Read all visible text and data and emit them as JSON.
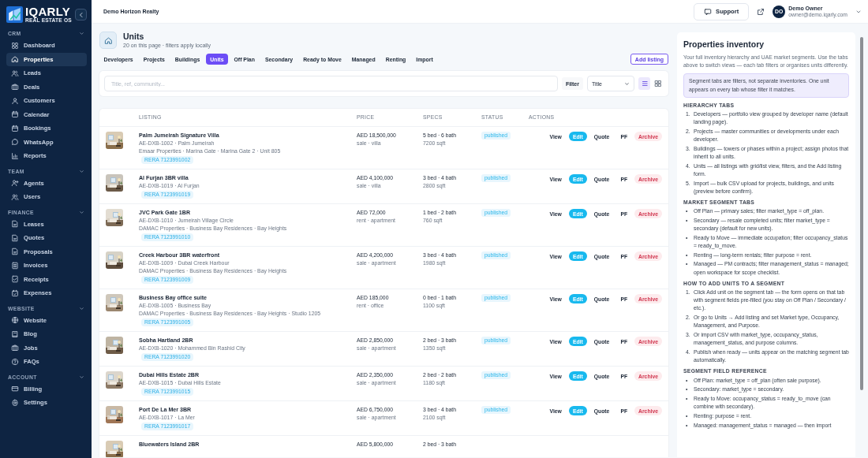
{
  "sidebar": {
    "logo": {
      "name": "IQARLY",
      "tagline": "REAL ESTATE OS"
    },
    "sections": [
      {
        "title": "CRM",
        "expanded": true,
        "items": [
          {
            "label": "Dashboard",
            "selected": false
          },
          {
            "label": "Properties",
            "selected": true
          },
          {
            "label": "Leads",
            "selected": false
          },
          {
            "label": "Deals",
            "selected": false
          },
          {
            "label": "Customers",
            "selected": false
          },
          {
            "label": "Calendar",
            "selected": false
          },
          {
            "label": "Bookings",
            "selected": false
          },
          {
            "label": "WhatsApp",
            "selected": false
          },
          {
            "label": "Reports",
            "selected": false
          }
        ]
      },
      {
        "title": "TEAM",
        "expanded": true,
        "items": [
          {
            "label": "Agents",
            "selected": false
          },
          {
            "label": "Users",
            "selected": false
          }
        ]
      },
      {
        "title": "FINANCE",
        "expanded": true,
        "items": [
          {
            "label": "Leases",
            "selected": false
          },
          {
            "label": "Quotes",
            "selected": false
          },
          {
            "label": "Proposals",
            "selected": false
          },
          {
            "label": "Invoices",
            "selected": false
          },
          {
            "label": "Receipts",
            "selected": false
          },
          {
            "label": "Expenses",
            "selected": false
          }
        ]
      },
      {
        "title": "WEBSITE",
        "expanded": true,
        "items": [
          {
            "label": "Website",
            "selected": false
          },
          {
            "label": "Blog",
            "selected": false
          },
          {
            "label": "Jobs",
            "selected": false
          },
          {
            "label": "FAQs",
            "selected": false
          }
        ]
      },
      {
        "title": "ACCOUNT",
        "expanded": true,
        "items": [
          {
            "label": "Billing",
            "selected": false
          },
          {
            "label": "Settings",
            "selected": false
          }
        ]
      }
    ]
  },
  "header": {
    "org": "Demo Horizon Realty",
    "support": "Support",
    "user": {
      "initials": "DO",
      "name": "Demo Owner",
      "email": "owner@demo.iqarly.com"
    }
  },
  "page": {
    "title": "Units",
    "subtitle": "20 on this page · filters apply locally",
    "tabs": [
      {
        "label": "Developers",
        "selected": false
      },
      {
        "label": "Projects",
        "selected": false
      },
      {
        "label": "Buildings",
        "selected": false
      },
      {
        "label": "Units",
        "selected": true
      },
      {
        "label": "Off Plan",
        "selected": false
      },
      {
        "label": "Secondary",
        "selected": false
      },
      {
        "label": "Ready to Move",
        "selected": false
      },
      {
        "label": "Managed",
        "selected": false
      },
      {
        "label": "Renting",
        "selected": false
      },
      {
        "label": "Import",
        "selected": false
      }
    ],
    "add_button": "Add listing",
    "search": {
      "placeholder": "Title, ref, community..."
    },
    "filter_button": "Filter",
    "sort": {
      "value": "Title"
    },
    "view_modes": [
      {
        "kind": "list",
        "selected": true
      },
      {
        "kind": "grid",
        "selected": false
      }
    ]
  },
  "table": {
    "columns": [
      "LISTING",
      "PRICE",
      "SPECS",
      "STATUS",
      "ACTIONS"
    ],
    "rows": [
      {
        "title": "Palm Jumeirah Signature Villa",
        "ref": "AE-DXB-1002 · Palm Jumeirah",
        "detail": "Emaar Properties · Marina Gate · Marina Gate 2 · Unit 805",
        "rera": "RERA 7123991002",
        "price": "AED 18,500,000",
        "price_note": "sale · villa",
        "specs": "5 bed · 6 bath",
        "area": "7200 sqft",
        "status": "published",
        "actions": [
          "View",
          "Edit",
          "Quote",
          "PF",
          "Archive"
        ]
      },
      {
        "title": "Al Furjan 3BR villa",
        "ref": "AE-DXB-1019 · Al Furjan",
        "rera": "RERA 7123991019",
        "price": "AED 4,100,000",
        "price_note": "sale · villa",
        "specs": "3 bed · 4 bath",
        "area": "2800 sqft",
        "status": "published",
        "actions": [
          "View",
          "Edit",
          "Quote",
          "PF",
          "Archive"
        ]
      },
      {
        "title": "JVC Park Gate 1BR",
        "ref": "AE-DXB-1010 · Jumeirah Village Circle",
        "detail": "DAMAC Properties · Business Bay Residences · Bay Heights",
        "rera": "RERA 7123991010",
        "price": "AED 72,000",
        "price_note": "rent · apartment",
        "specs": "1 bed · 2 bath",
        "area": "760 sqft",
        "status": "published",
        "actions": [
          "View",
          "Edit",
          "Quote",
          "PF",
          "Archive"
        ]
      },
      {
        "title": "Creek Harbour 3BR waterfront",
        "ref": "AE-DXB-1009 · Dubai Creek Harbour",
        "detail": "DAMAC Properties · Business Bay Residences · Bay Heights",
        "rera": "RERA 7123991009",
        "price": "AED 4,200,000",
        "price_note": "sale · apartment",
        "specs": "3 bed · 4 bath",
        "area": "1980 sqft",
        "status": "published",
        "actions": [
          "View",
          "Edit",
          "Quote",
          "PF",
          "Archive"
        ]
      },
      {
        "title": "Business Bay office suite",
        "ref": "AE-DXB-1005 · Business Bay",
        "detail": "DAMAC Properties · Business Bay Residences · Bay Heights · Studio 1205",
        "rera": "RERA 7123991005",
        "price": "AED 185,000",
        "price_note": "rent · office",
        "specs": "0 bed · 1 bath",
        "area": "1100 sqft",
        "status": "published",
        "actions": [
          "View",
          "Edit",
          "Quote",
          "PF",
          "Archive"
        ]
      },
      {
        "title": "Sobha Hartland 2BR",
        "ref": "AE-DXB-1020 · Mohammed Bin Rashid City",
        "rera": "RERA 7123991020",
        "price": "AED 2,850,000",
        "price_note": "sale · apartment",
        "specs": "2 bed · 3 bath",
        "area": "1350 sqft",
        "status": "published",
        "actions": [
          "View",
          "Edit",
          "Quote",
          "PF",
          "Archive"
        ]
      },
      {
        "title": "Dubai Hills Estate 2BR",
        "ref": "AE-DXB-1015 · Dubai Hills Estate",
        "rera": "RERA 7123991015",
        "price": "AED 2,350,000",
        "price_note": "sale · apartment",
        "specs": "2 bed · 2 bath",
        "area": "1180 sqft",
        "status": "published",
        "actions": [
          "View",
          "Edit",
          "Quote",
          "PF",
          "Archive"
        ]
      },
      {
        "title": "Port De La Mer 3BR",
        "ref": "AE-DXB-1017 · La Mer",
        "rera": "RERA 7123991017",
        "price": "AED 6,750,000",
        "price_note": "sale · apartment",
        "specs": "3 bed · 4 bath",
        "area": "2100 sqft",
        "status": "published",
        "actions": [
          "View",
          "Edit",
          "Quote",
          "PF",
          "Archive"
        ]
      },
      {
        "title": "Bluewaters Island 2BR",
        "price": "AED 5,800,000",
        "specs": "2 bed · 3 bath"
      }
    ]
  },
  "panel": {
    "title": "Properties inventory",
    "intro": "Your full inventory hierarchy and UAE market segments. Use the tabs above to switch views — each tab filters or organises units differently.",
    "note": "Segment tabs are filters, not separate inventories. One unit appears on every tab whose filter it matches.",
    "sections": [
      {
        "heading": "HIERARCHY TABS",
        "items": [
          {
            "marker": "1.",
            "text": "Developers — portfolio view grouped by developer name (default landing page)."
          },
          {
            "marker": "2.",
            "text": "Projects — master communities or developments under each developer."
          },
          {
            "marker": "3.",
            "text": "Buildings — towers or phases within a project; assign photos that inherit to all units."
          },
          {
            "marker": "4.",
            "text": "Units — all listings with grid/list view, filters, and the Add listing form."
          },
          {
            "marker": "5.",
            "text": "Import — bulk CSV upload for projects, buildings, and units (preview before confirm)."
          }
        ]
      },
      {
        "heading": "MARKET SEGMENT TABS",
        "items": [
          {
            "marker": "•",
            "text": "Off Plan — primary sales; filter market_type = off_plan."
          },
          {
            "marker": "•",
            "text": "Secondary — resale completed units; filter market_type = secondary (default for new units)."
          },
          {
            "marker": "•",
            "text": "Ready to Move — immediate occupation; filter occupancy_status = ready_to_move."
          },
          {
            "marker": "•",
            "text": "Renting — long-term rentals; filter purpose = rent."
          },
          {
            "marker": "•",
            "text": "Managed — PM contracts; filter management_status = managed; open workspace for scope checklist."
          }
        ]
      },
      {
        "heading": "HOW TO ADD UNITS TO A SEGMENT",
        "items": [
          {
            "marker": "1.",
            "text": "Click Add unit on the segment tab — the form opens on that tab with segment fields pre-filled (you stay on Off Plan / Secondary / etc.)."
          },
          {
            "marker": "2.",
            "text": "Or go to Units → Add listing and set Market type, Occupancy, Management, and Purpose."
          },
          {
            "marker": "3.",
            "text": "Or import CSV with market_type, occupancy_status, management_status, and purpose columns."
          },
          {
            "marker": "4.",
            "text": "Publish when ready — units appear on the matching segment tab automatically."
          }
        ]
      },
      {
        "heading": "SEGMENT FIELD REFERENCE",
        "items": [
          {
            "marker": "•",
            "text": "Off Plan: market_type = off_plan (often sale purpose)."
          },
          {
            "marker": "•",
            "text": "Secondary: market_type = secondary."
          },
          {
            "marker": "•",
            "text": "Ready to Move: occupancy_status = ready_to_move (can combine with secondary)."
          },
          {
            "marker": "•",
            "text": "Renting: purpose = rent."
          },
          {
            "marker": "•",
            "text": "Managed: management_status = managed — then import"
          }
        ]
      }
    ]
  }
}
